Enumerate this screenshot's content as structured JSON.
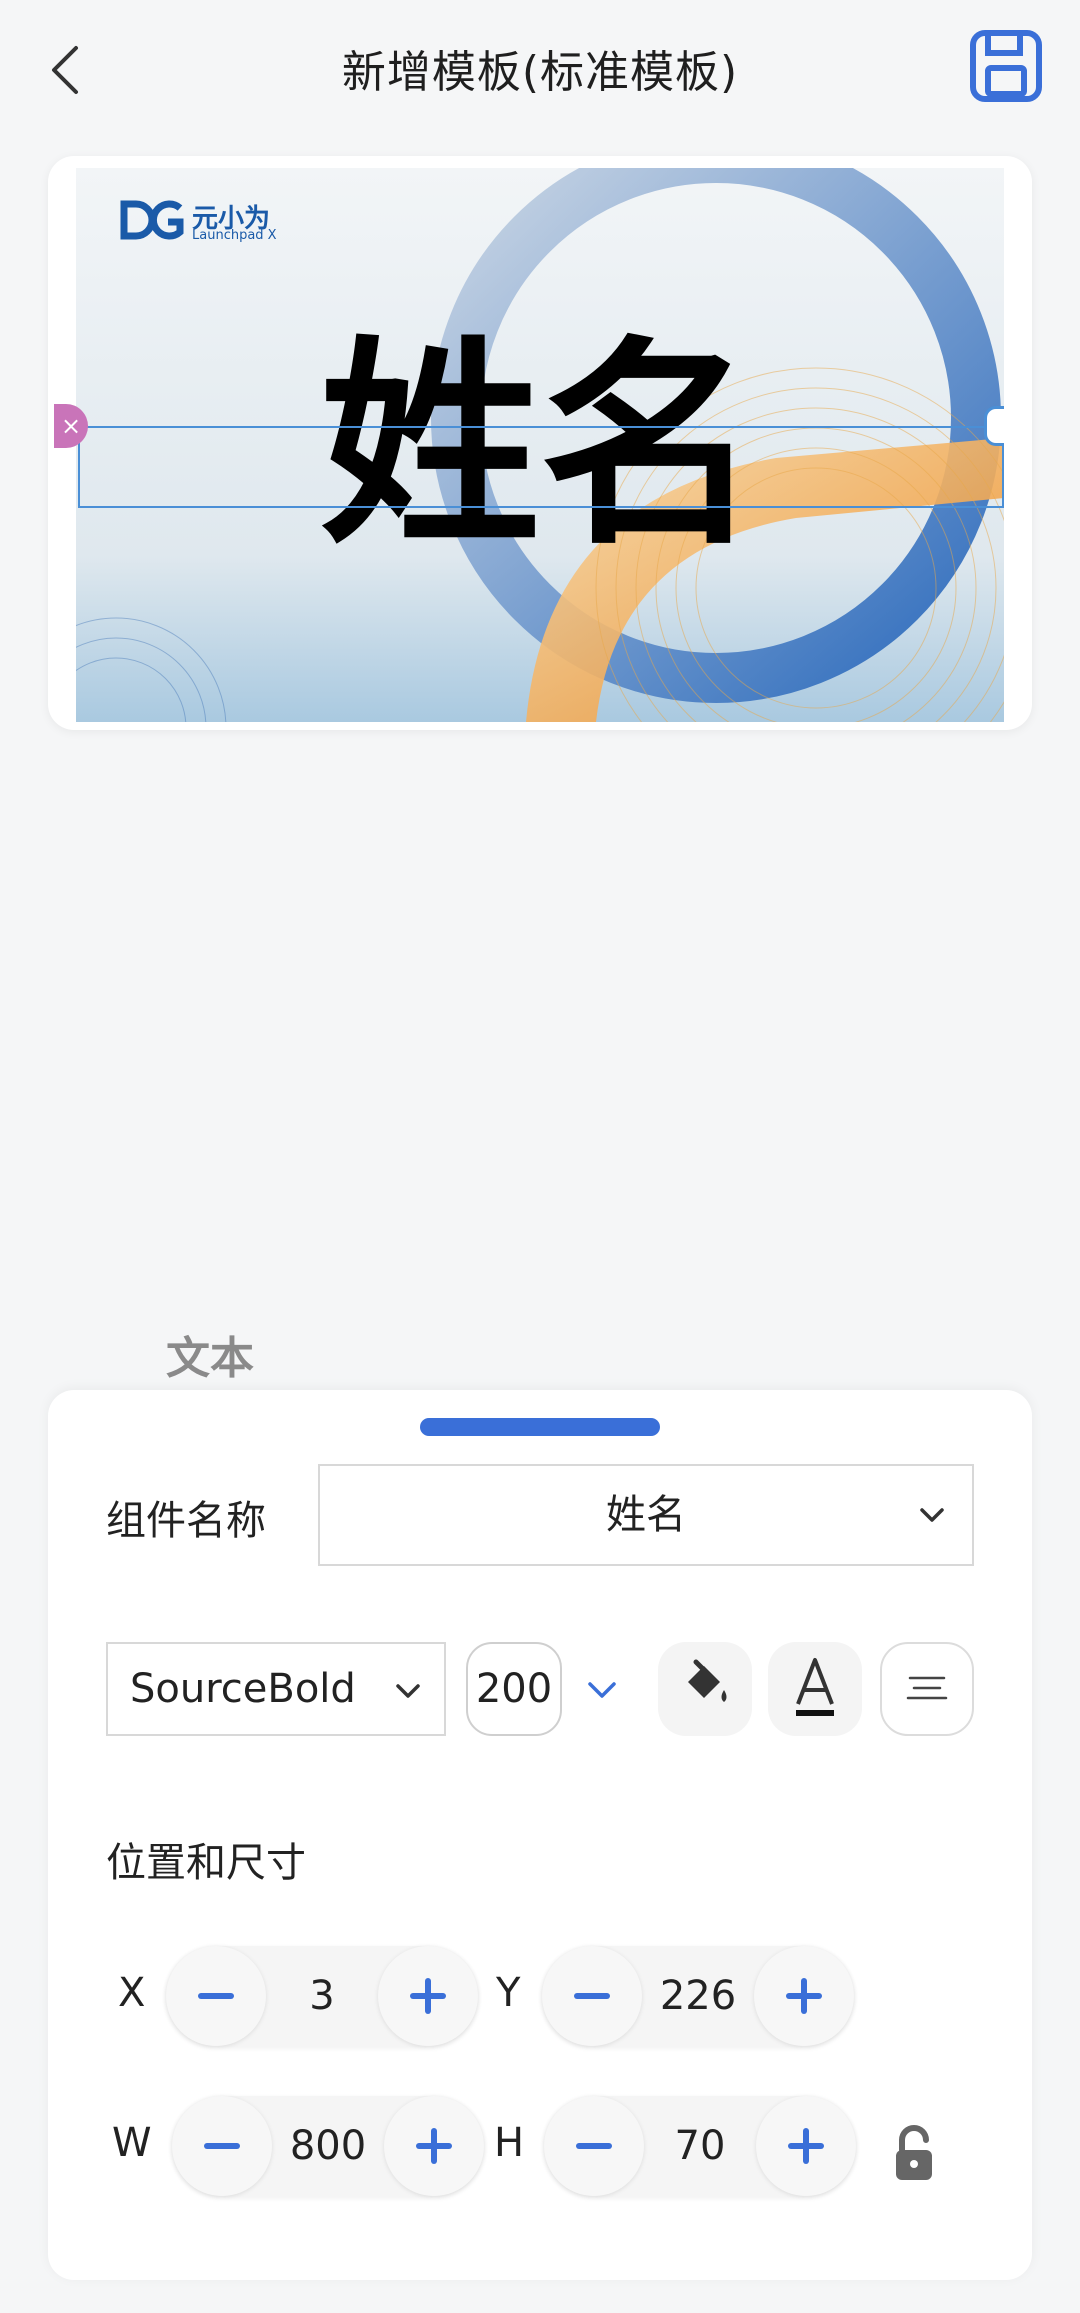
{
  "header": {
    "title": "新增模板(标准模板)"
  },
  "canvas": {
    "logo_text": "元小为",
    "logo_sub": "Launchpad X",
    "name_text": "姓名"
  },
  "section_label": "文本",
  "panel": {
    "component_name_label": "组件名称",
    "component_name_value": "姓名",
    "font_family_value": "SourceBold",
    "font_size_value": "200",
    "position_label": "位置和尺寸",
    "x_label": "X",
    "x_value": "3",
    "y_label": "Y",
    "y_value": "226",
    "w_label": "W",
    "w_value": "800",
    "h_label": "H",
    "h_value": "70"
  },
  "colors": {
    "accent": "#3a6fd8",
    "selection": "#4a8fd6",
    "delete_handle": "#c974b9"
  },
  "icons": [
    "back-arrow-icon",
    "save-icon",
    "chevron-down-icon",
    "fill-color-icon",
    "text-color-icon",
    "align-center-icon",
    "minus-icon",
    "plus-icon",
    "unlock-icon"
  ]
}
